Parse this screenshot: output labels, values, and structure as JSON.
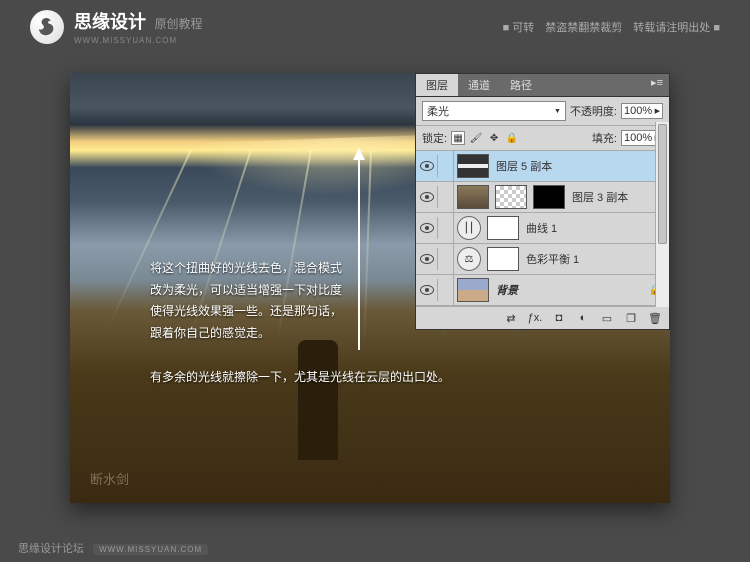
{
  "header": {
    "brand": "思缘设计",
    "brand_sub": "原创教程",
    "brand_url": "WWW.MISSYUAN.COM",
    "right_text": "■ 可转　禁盗禁翻禁裁剪　转载请注明出处 ■"
  },
  "annotations": {
    "text1": "将这个扭曲好的光线去色，混合模式\n改为柔光，可以适当增强一下对比度\n使得光线效果强一些。还是那句话，\n跟着你自己的感觉走。",
    "text2": "有多余的光线就擦除一下，尤其是光线在云层的出口处。",
    "watermark": "断水剑"
  },
  "panel": {
    "tabs": {
      "layers": "图层",
      "channels": "通道",
      "paths": "路径"
    },
    "blend_mode": "柔光",
    "opacity_label": "不透明度:",
    "opacity_value": "100%",
    "lock_label": "锁定:",
    "fill_label": "填充:",
    "fill_value": "100%",
    "layers": [
      {
        "name": "图层 5 副本"
      },
      {
        "name": "图层 3 副本"
      },
      {
        "name": "曲线 1"
      },
      {
        "name": "色彩平衡 1"
      },
      {
        "name": "背景"
      }
    ]
  },
  "footer": {
    "text": "思缘设计论坛",
    "url": "WWW.MISSYUAN.COM"
  }
}
